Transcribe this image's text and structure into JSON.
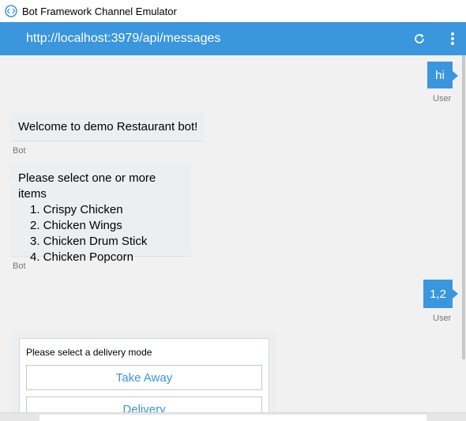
{
  "window": {
    "title": "Bot Framework Channel Emulator",
    "icon": "emulator-logo-icon"
  },
  "addressbar": {
    "url": "http://localhost:3979/api/messages",
    "refresh_icon": "refresh-icon",
    "more_icon": "more-vertical-icon"
  },
  "colors": {
    "accent": "#3a96dd",
    "bot_bubble": "#eceff1",
    "background": "#f1f1f1"
  },
  "messages": [
    {
      "from": "User",
      "text": "hi"
    },
    {
      "from": "Bot",
      "text": "Welcome to demo Restaurant bot!"
    },
    {
      "from": "Bot",
      "text": "Please select one or more items",
      "items": [
        "1. Crispy Chicken",
        "2. Chicken Wings",
        "3. Chicken Drum Stick",
        "4. Chicken Popcorn"
      ]
    },
    {
      "from": "User",
      "text": "1,2"
    }
  ],
  "card": {
    "prompt": "Please select a delivery mode",
    "actions": [
      "Take Away",
      "Delivery"
    ]
  }
}
